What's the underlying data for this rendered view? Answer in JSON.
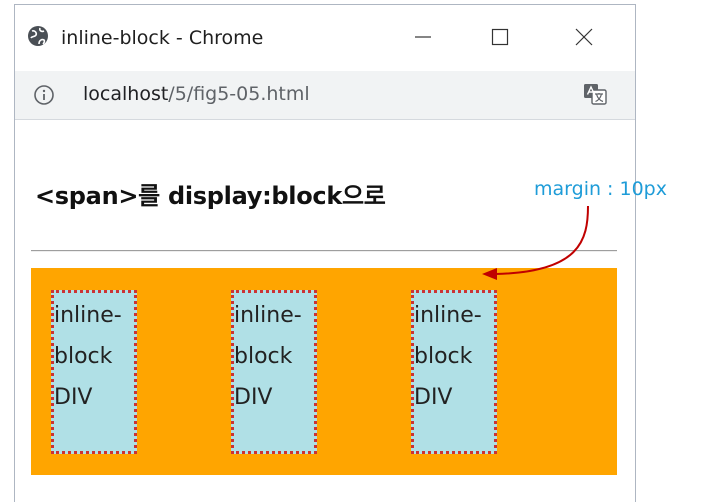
{
  "window": {
    "title": "inline-block - Chrome"
  },
  "address_bar": {
    "host": "localhost",
    "path": "/5/fig5-05.html"
  },
  "page": {
    "heading": "<span>를 display:block으로",
    "boxes": [
      {
        "lines": [
          "inline-",
          "block",
          "DIV"
        ]
      },
      {
        "lines": [
          "inline-",
          "block",
          "DIV"
        ]
      },
      {
        "lines": [
          "inline-",
          "block",
          "DIV"
        ]
      }
    ]
  },
  "annotation": {
    "text": "margin : 10px",
    "color": "#1e9cd8",
    "arrow_color": "#c00000"
  },
  "colors": {
    "container": "#ffa500",
    "box": "#b0e0e6",
    "box_border": "#cc3333"
  },
  "icons": {
    "favicon": "globe-icon",
    "info": "info-icon",
    "translate": "translate-icon",
    "minimize": "minimize-icon",
    "maximize": "maximize-icon",
    "close": "close-icon"
  }
}
